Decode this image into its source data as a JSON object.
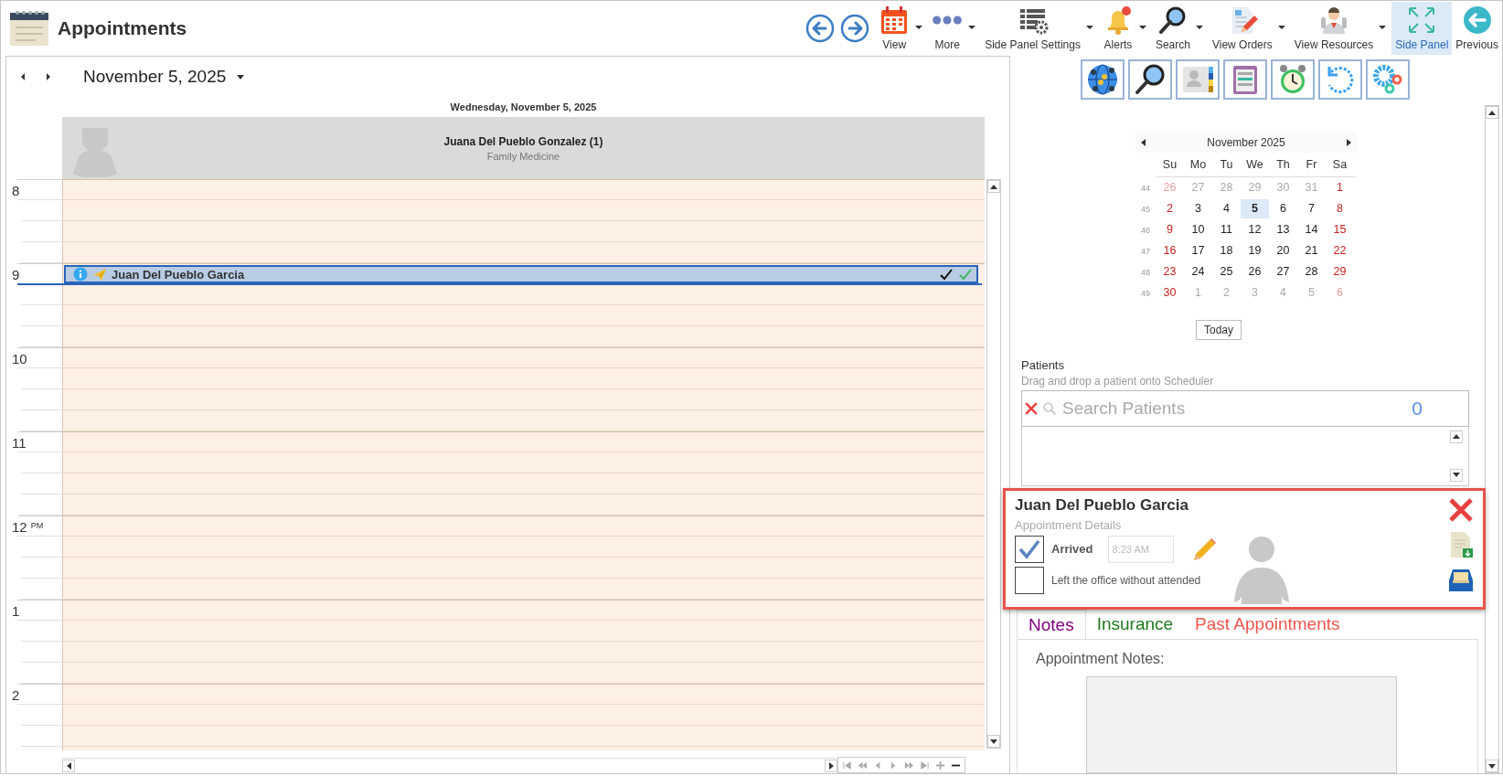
{
  "app": {
    "title": "Appointments"
  },
  "toolbar": {
    "items": [
      {
        "label": "View",
        "dropdown": true,
        "selected": false
      },
      {
        "label": "More",
        "dropdown": true,
        "selected": false
      },
      {
        "label": "Side Panel Settings",
        "dropdown": true,
        "selected": false
      },
      {
        "label": "Alerts",
        "dropdown": true,
        "selected": false
      },
      {
        "label": "Search",
        "dropdown": true,
        "selected": false
      },
      {
        "label": "View Orders",
        "dropdown": true,
        "selected": false
      },
      {
        "label": "View Resources",
        "dropdown": true,
        "selected": false
      },
      {
        "label": "Side Panel",
        "dropdown": false,
        "selected": true
      },
      {
        "label": "Previous",
        "dropdown": false,
        "selected": false
      }
    ]
  },
  "scheduler": {
    "date": "November 5, 2025",
    "day_header": "Wednesday, November 5, 2025",
    "resource": {
      "name": "Juana Del Pueblo Gonzalez (1)",
      "specialty": "Family Medicine"
    },
    "hours": [
      {
        "label": "8"
      },
      {
        "label": "9"
      },
      {
        "label": "10"
      },
      {
        "label": "11"
      },
      {
        "label": "12",
        "suffix": "PM"
      },
      {
        "label": "1"
      },
      {
        "label": "2"
      }
    ],
    "appointments": [
      {
        "patient": "Juan Del Pueblo Garcia",
        "selected": true
      }
    ]
  },
  "side_panel": {
    "calendar": {
      "title": "November 2025",
      "weekdays": [
        "Su",
        "Mo",
        "Tu",
        "We",
        "Th",
        "Fr",
        "Sa"
      ],
      "weeks": [
        {
          "number": "44",
          "days": [
            {
              "day": "26",
              "kind": "other",
              "weekend": true,
              "selected": false
            },
            {
              "day": "27",
              "kind": "other",
              "weekend": false,
              "selected": false
            },
            {
              "day": "28",
              "kind": "other",
              "weekend": false,
              "selected": false
            },
            {
              "day": "29",
              "kind": "other",
              "weekend": false,
              "selected": false
            },
            {
              "day": "30",
              "kind": "other",
              "weekend": false,
              "selected": false
            },
            {
              "day": "31",
              "kind": "other",
              "weekend": false,
              "selected": false
            },
            {
              "day": "1",
              "kind": "current",
              "weekend": true,
              "selected": false
            }
          ]
        },
        {
          "number": "45",
          "days": [
            {
              "day": "2",
              "kind": "current",
              "weekend": true,
              "selected": false
            },
            {
              "day": "3",
              "kind": "current",
              "weekend": false,
              "selected": false
            },
            {
              "day": "4",
              "kind": "current",
              "weekend": false,
              "selected": false
            },
            {
              "day": "5",
              "kind": "current",
              "weekend": false,
              "selected": true
            },
            {
              "day": "6",
              "kind": "current",
              "weekend": false,
              "selected": false
            },
            {
              "day": "7",
              "kind": "current",
              "weekend": false,
              "selected": false
            },
            {
              "day": "8",
              "kind": "current",
              "weekend": true,
              "selected": false
            }
          ]
        },
        {
          "number": "46",
          "days": [
            {
              "day": "9",
              "kind": "current",
              "weekend": true,
              "selected": false
            },
            {
              "day": "10",
              "kind": "current",
              "weekend": false,
              "selected": false
            },
            {
              "day": "11",
              "kind": "current",
              "weekend": false,
              "selected": false
            },
            {
              "day": "12",
              "kind": "current",
              "weekend": false,
              "selected": false
            },
            {
              "day": "13",
              "kind": "current",
              "weekend": false,
              "selected": false
            },
            {
              "day": "14",
              "kind": "current",
              "weekend": false,
              "selected": false
            },
            {
              "day": "15",
              "kind": "current",
              "weekend": true,
              "selected": false
            }
          ]
        },
        {
          "number": "47",
          "days": [
            {
              "day": "16",
              "kind": "current",
              "weekend": true,
              "selected": false
            },
            {
              "day": "17",
              "kind": "current",
              "weekend": false,
              "selected": false
            },
            {
              "day": "18",
              "kind": "current",
              "weekend": false,
              "selected": false
            },
            {
              "day": "19",
              "kind": "current",
              "weekend": false,
              "selected": false
            },
            {
              "day": "20",
              "kind": "current",
              "weekend": false,
              "selected": false
            },
            {
              "day": "21",
              "kind": "current",
              "weekend": false,
              "selected": false
            },
            {
              "day": "22",
              "kind": "current",
              "weekend": true,
              "selected": false
            }
          ]
        },
        {
          "number": "48",
          "days": [
            {
              "day": "23",
              "kind": "current",
              "weekend": true,
              "selected": false
            },
            {
              "day": "24",
              "kind": "current",
              "weekend": false,
              "selected": false
            },
            {
              "day": "25",
              "kind": "current",
              "weekend": false,
              "selected": false
            },
            {
              "day": "26",
              "kind": "current",
              "weekend": false,
              "selected": false
            },
            {
              "day": "27",
              "kind": "current",
              "weekend": false,
              "selected": false
            },
            {
              "day": "28",
              "kind": "current",
              "weekend": false,
              "selected": false
            },
            {
              "day": "29",
              "kind": "current",
              "weekend": true,
              "selected": false
            }
          ]
        },
        {
          "number": "49",
          "days": [
            {
              "day": "30",
              "kind": "current",
              "weekend": true,
              "selected": false
            },
            {
              "day": "1",
              "kind": "other",
              "weekend": false,
              "selected": false
            },
            {
              "day": "2",
              "kind": "other",
              "weekend": false,
              "selected": false
            },
            {
              "day": "3",
              "kind": "other",
              "weekend": false,
              "selected": false
            },
            {
              "day": "4",
              "kind": "other",
              "weekend": false,
              "selected": false
            },
            {
              "day": "5",
              "kind": "other",
              "weekend": false,
              "selected": false
            },
            {
              "day": "6",
              "kind": "other",
              "weekend": true,
              "selected": false
            }
          ]
        }
      ],
      "today_button": "Today"
    },
    "patients": {
      "title": "Patients",
      "hint": "Drag and drop a patient onto Scheduler",
      "search_placeholder": "Search Patients",
      "count": "0"
    },
    "details": {
      "patient": "Juan Del Pueblo Garcia",
      "subtitle": "Appointment Details",
      "arrived": {
        "label": "Arrived",
        "checked": true,
        "time": "8:23 AM"
      },
      "left": {
        "label": "Left the office without attended",
        "checked": false
      }
    },
    "tabs": [
      {
        "label": "Notes",
        "color": "#800080",
        "selected": true
      },
      {
        "label": "Insurance",
        "color": "#1e7a1e",
        "selected": false
      },
      {
        "label": "Past Appointments",
        "color": "#f0544a",
        "selected": false
      }
    ],
    "notes_label": "Appointment Notes:"
  }
}
